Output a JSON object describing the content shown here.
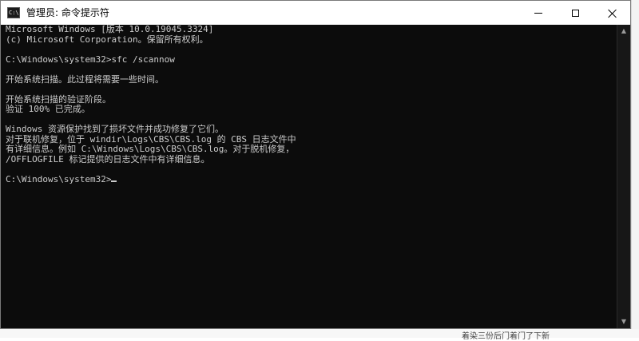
{
  "window": {
    "title": "管理员: 命令提示符",
    "icon_label": "C:\\"
  },
  "icons": {
    "app": "command-prompt-icon",
    "minimize": "minimize-icon",
    "maximize": "maximize-icon",
    "close": "close-icon",
    "scroll_up": "chevron-up-icon",
    "scroll_down": "chevron-down-icon"
  },
  "console": {
    "lines": [
      "Microsoft Windows [版本 10.0.19045.3324]",
      "(c) Microsoft Corporation。保留所有权利。",
      "",
      "C:\\Windows\\system32>sfc /scannow",
      "",
      "开始系统扫描。此过程将需要一些时间。",
      "",
      "开始系统扫描的验证阶段。",
      "验证 100% 已完成。",
      "",
      "Windows 资源保护找到了损坏文件并成功修复了它们。",
      "对于联机修复，位于 windir\\Logs\\CBS\\CBS.log 的 CBS 日志文件中",
      "有详细信息。例如 C:\\Windows\\Logs\\CBS\\CBS.log。对于脱机修复，",
      "/OFFLOGFILE 标记提供的日志文件中有详细信息。",
      "",
      "C:\\Windows\\system32>"
    ]
  },
  "background": {
    "bottom_text": "着染三份后门着门了下新"
  },
  "colors": {
    "console_bg": "#0c0c0c",
    "console_text": "#cccccc",
    "titlebar_bg": "#ffffff",
    "scrollbar_bg": "#171717"
  }
}
